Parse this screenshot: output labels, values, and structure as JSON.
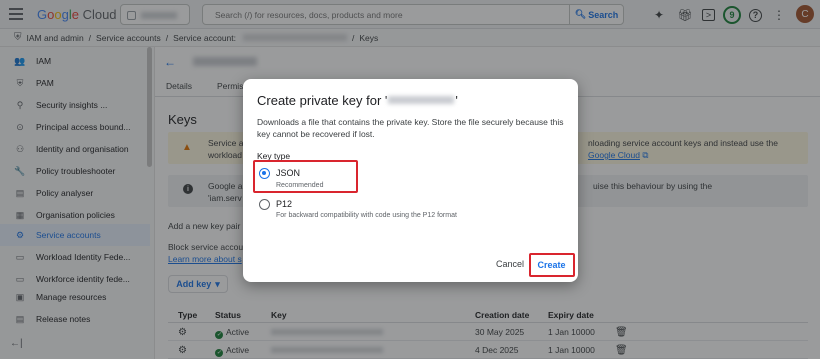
{
  "app": {
    "logo_google": "Google",
    "logo_cloud": "Cloud"
  },
  "search": {
    "placeholder": "Search (/) for resources, docs, products and more",
    "button_label": "Search"
  },
  "topbar": {
    "notifications_count": "9",
    "avatar_initial": "C"
  },
  "breadcrumb": {
    "item1": "IAM and admin",
    "sep": "/",
    "item2": "Service accounts",
    "item3": "Service account:",
    "item4": "Keys"
  },
  "sidebar": {
    "items": [
      {
        "label": "IAM",
        "icon": "person-add-icon",
        "glyph": "👥"
      },
      {
        "label": "PAM",
        "icon": "shield-icon",
        "glyph": "⛨"
      },
      {
        "label": "Security insights ...",
        "icon": "insights-icon",
        "glyph": "⚲"
      },
      {
        "label": "Principal access bound...",
        "icon": "access-icon",
        "glyph": "⊙"
      },
      {
        "label": "Identity and organisation",
        "icon": "identity-icon",
        "glyph": "⚇"
      },
      {
        "label": "Policy troubleshooter",
        "icon": "wrench-icon",
        "glyph": "🔧"
      },
      {
        "label": "Policy analyser",
        "icon": "analyser-icon",
        "glyph": "▤"
      },
      {
        "label": "Organisation policies",
        "icon": "policy-icon",
        "glyph": "▦"
      },
      {
        "label": "Service accounts",
        "icon": "service-account-icon",
        "glyph": "⚙"
      },
      {
        "label": "Workload Identity Fede...",
        "icon": "workload-icon",
        "glyph": "▭"
      },
      {
        "label": "Workforce identity fede...",
        "icon": "workforce-icon",
        "glyph": "▭"
      },
      {
        "label": "Manage resources",
        "icon": "folder-icon",
        "glyph": "▣"
      },
      {
        "label": "Release notes",
        "icon": "notes-icon",
        "glyph": "▤"
      }
    ],
    "active_index": 8
  },
  "main": {
    "tabs": [
      "Details",
      "Permis"
    ],
    "title": "Keys",
    "warning_line1": "Service a",
    "warning_line2": "workload",
    "warning_line3": "nloading service account keys and instead use the",
    "warning_link": "Google Cloud",
    "info_line1": "Google a",
    "info_line2": "'iam.serv",
    "info_line3": "uise this behaviour by using the",
    "add_key_pair": "Add a new key pair o",
    "block_text": "Block service accou",
    "learn_more": "Learn more about s",
    "add_key_button": "Add key",
    "table": {
      "headers": [
        "Type",
        "Status",
        "Key",
        "Creation date",
        "Expiry date"
      ],
      "rows": [
        {
          "status": "Active",
          "created": "30 May 2025",
          "expiry": "1 Jan 10000"
        },
        {
          "status": "Active",
          "created": "4 Dec 2025",
          "expiry": "1 Jan 10000"
        }
      ]
    }
  },
  "dialog": {
    "title_prefix": "Create private key for '",
    "title_suffix": "'",
    "description": "Downloads a file that contains the private key. Store the file securely because this key cannot be recovered if lost.",
    "key_type_label": "Key type",
    "options": [
      {
        "label": "JSON",
        "sublabel": "Recommended",
        "selected": true
      },
      {
        "label": "P12",
        "sublabel": "For backward compatibility with code using the P12 format",
        "selected": false
      }
    ],
    "cancel_label": "Cancel",
    "create_label": "Create",
    "highlight_color": "#d9252e",
    "accent_color": "#1a73e8"
  }
}
